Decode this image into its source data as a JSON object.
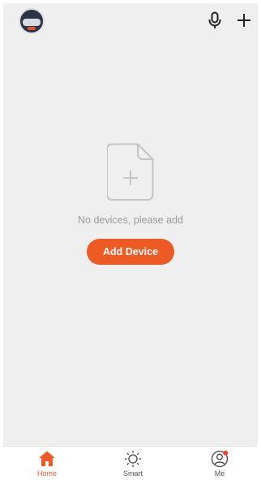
{
  "header": {
    "avatar_icon": "avatar-icon",
    "mic_icon": "microphone-icon",
    "add_icon": "plus-icon"
  },
  "empty_state": {
    "icon": "add-file-icon",
    "message": "No devices, please add",
    "button_label": "Add Device"
  },
  "tabs": [
    {
      "label": "Home",
      "icon": "home-icon",
      "active": true
    },
    {
      "label": "Smart",
      "icon": "sun-icon",
      "active": false
    },
    {
      "label": "Me",
      "icon": "user-icon",
      "active": false,
      "badge": true
    }
  ],
  "colors": {
    "accent": "#ee5a24",
    "background": "#efefef",
    "badge": "#ff3b30"
  }
}
